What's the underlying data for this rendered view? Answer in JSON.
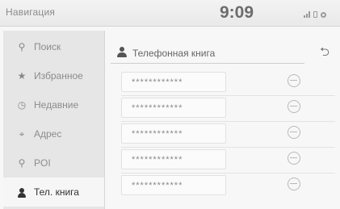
{
  "status_bar": {
    "title": "Навигация",
    "time": "9:09",
    "icons": [
      "signal-icon",
      "bluetooth-icon",
      "settings-icon"
    ]
  },
  "sidebar": {
    "items": [
      {
        "label": "Поиск",
        "icon": "search-icon",
        "glyph": "⚲",
        "active": false
      },
      {
        "label": "Избранное",
        "icon": "star-icon",
        "glyph": "★",
        "active": false
      },
      {
        "label": "Недавние",
        "icon": "clock-icon",
        "glyph": "◷",
        "active": false
      },
      {
        "label": "Адрес",
        "icon": "address-icon",
        "glyph": "⌖",
        "active": false
      },
      {
        "label": "POI",
        "icon": "poi-pin-icon",
        "glyph": "⚲",
        "active": false
      },
      {
        "label": "Тел. книга",
        "icon": "person-icon",
        "glyph": "👤",
        "active": true
      }
    ]
  },
  "main": {
    "header_title": "Телефонная книга",
    "back_glyph": "⮌",
    "entries": [
      {
        "text": "************"
      },
      {
        "text": "************"
      },
      {
        "text": "************"
      },
      {
        "text": "************"
      },
      {
        "text": "************"
      }
    ]
  }
}
